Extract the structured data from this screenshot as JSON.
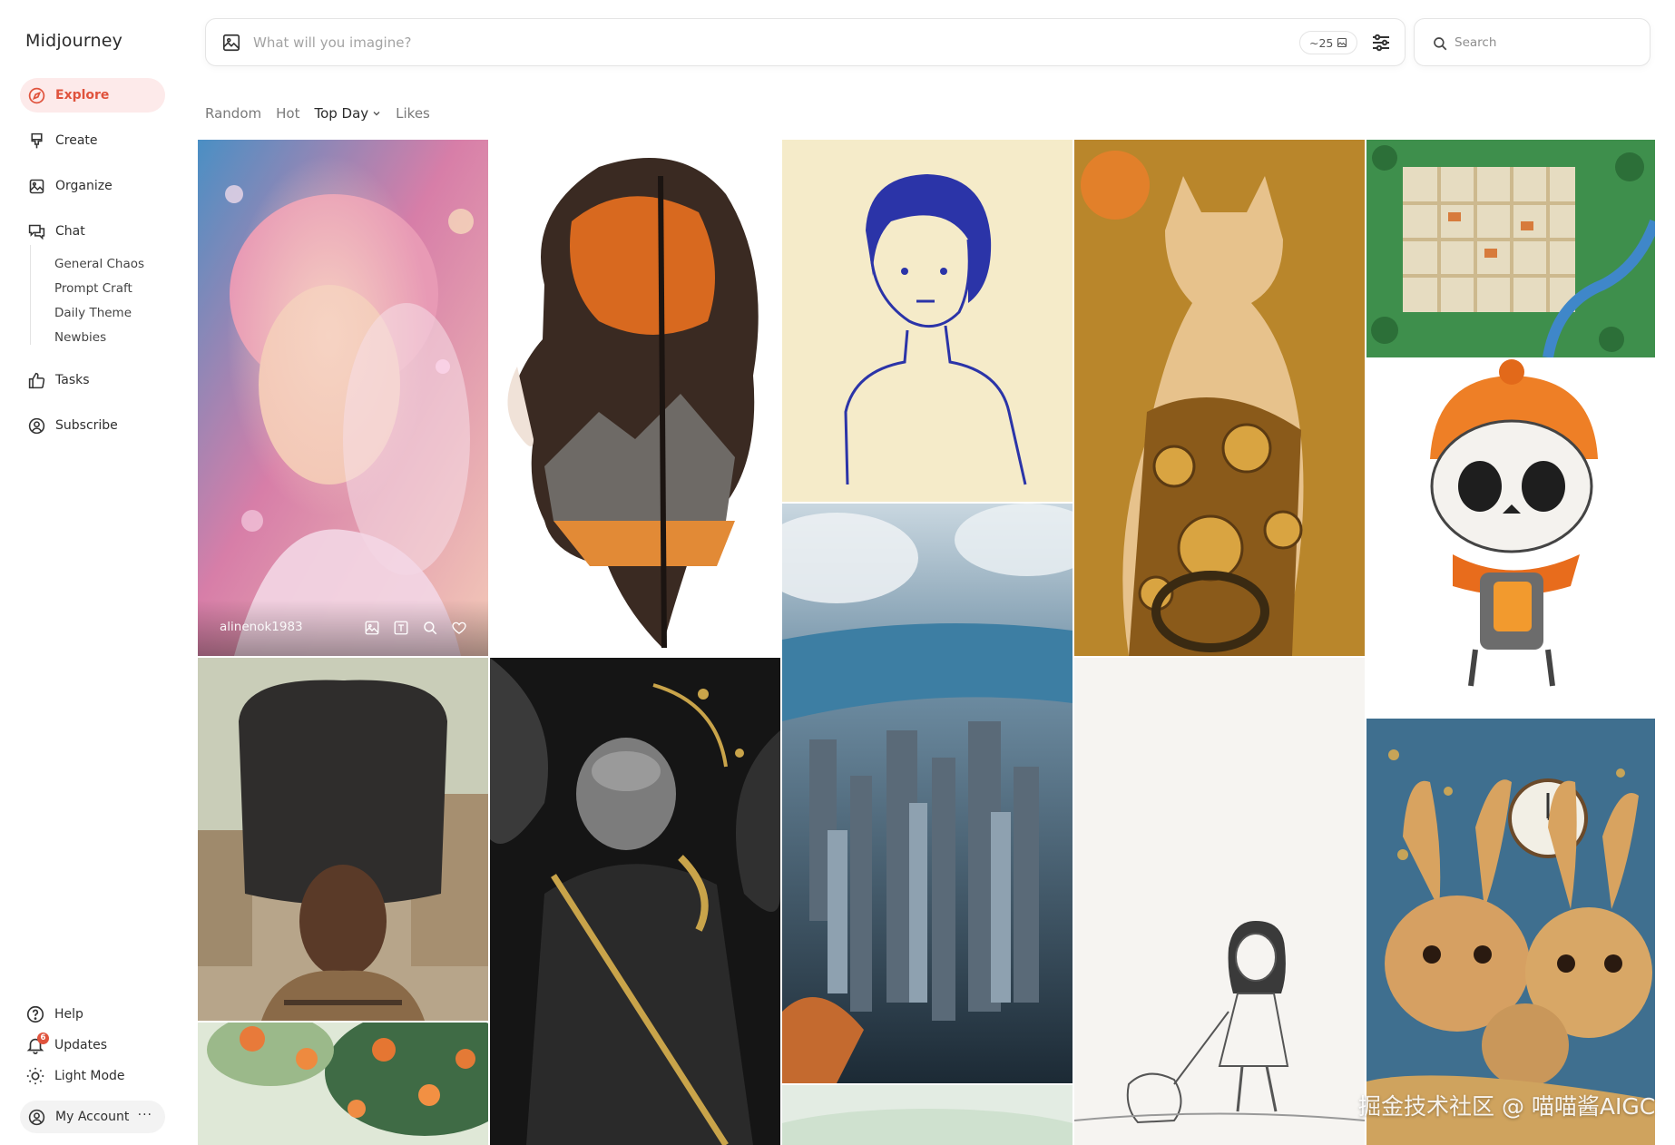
{
  "brand": {
    "title": "Midjourney"
  },
  "nav": {
    "explore": "Explore",
    "create": "Create",
    "organize": "Organize",
    "chat": "Chat",
    "chat_rooms": [
      "General Chaos",
      "Prompt Craft",
      "Daily Theme",
      "Newbies"
    ],
    "tasks": "Tasks",
    "subscribe": "Subscribe"
  },
  "bottom_nav": {
    "help": "Help",
    "updates": "Updates",
    "updates_badge": "6",
    "light_mode": "Light Mode",
    "account": "My Account",
    "account_more": "···"
  },
  "prompt": {
    "placeholder": "What will you imagine?",
    "counter": "~25"
  },
  "search": {
    "placeholder": "Search"
  },
  "filters": {
    "random": "Random",
    "hot": "Hot",
    "top_day": "Top Day",
    "likes": "Likes"
  },
  "gallery": {
    "hovered_author": "alinenok1983"
  },
  "watermark": "掘金技术社区 @ 喵喵酱AIGC",
  "colors": {
    "accent": "#e0533d",
    "accent_bg": "#fdeaea"
  }
}
